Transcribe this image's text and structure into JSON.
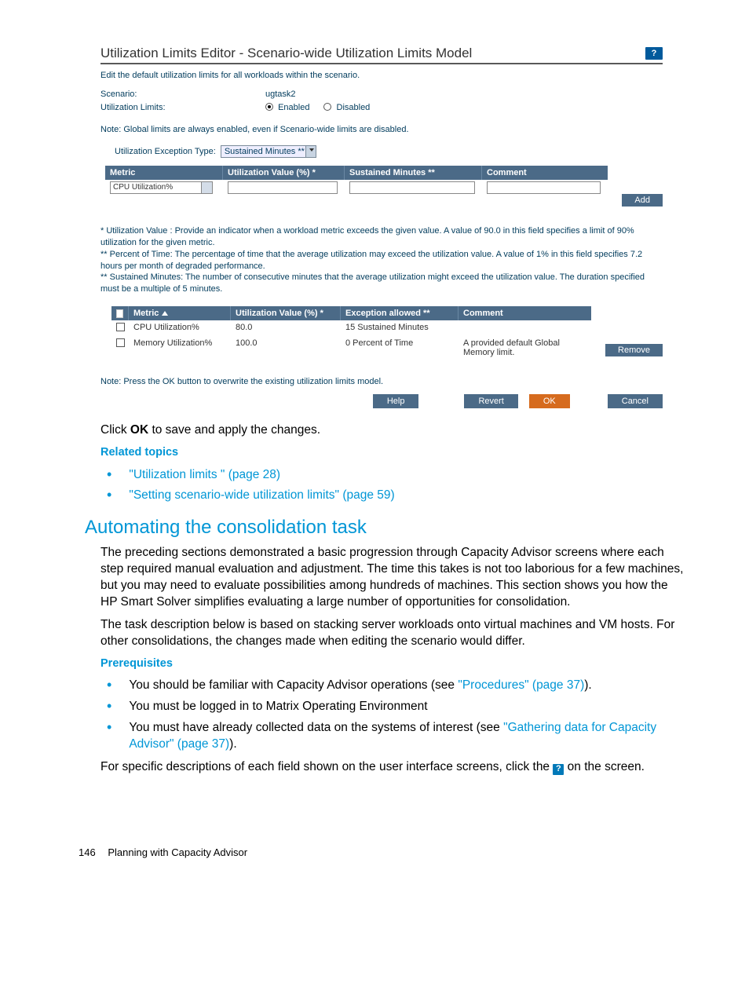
{
  "screenshot": {
    "title": "Utilization Limits Editor - Scenario-wide Utilization Limits Model",
    "help_badge": "?",
    "subtitle": "Edit the default utilization limits for all workloads within the scenario.",
    "scenario_label": "Scenario:",
    "scenario_value": "ugtask2",
    "util_limits_label": "Utilization Limits:",
    "radio_enabled": "Enabled",
    "radio_disabled": "Disabled",
    "note1": "Note: Global limits are always enabled, even if Scenario-wide limits are disabled.",
    "exc_type_label": "Utilization Exception Type:",
    "exc_type_value": "Sustained Minutes **",
    "entry_table": {
      "h_metric": "Metric",
      "h_util": "Utilization Value (%) *",
      "h_sust": "Sustained Minutes **",
      "h_comment": "Comment",
      "metric_value": "CPU Utilization%"
    },
    "add_btn": "Add",
    "explain": "* Utilization Value : Provide an indicator when a workload metric exceeds the given value. A value of 90.0 in this field specifies a limit of 90% utilization for the given metric.\n** Percent of Time: The percentage of time that the average utilization may exceed the utilization value. A value of 1% in this field specifies 7.2 hours per month of degraded performance.\n** Sustained Minutes: The number of consecutive minutes that the average utilization might exceed the utilization value. The duration specified must be a multiple of 5 minutes.",
    "list_table": {
      "h_metric": "Metric",
      "h_util": "Utilization Value (%) *",
      "h_exc": "Exception allowed **",
      "h_comment": "Comment",
      "rows": [
        {
          "metric": "CPU Utilization%",
          "util": "80.0",
          "exc": "15 Sustained Minutes",
          "comment": ""
        },
        {
          "metric": "Memory Utilization%",
          "util": "100.0",
          "exc": "0 Percent of Time",
          "comment": "A provided default Global Memory limit."
        }
      ]
    },
    "remove_btn": "Remove",
    "note2": "Note: Press the OK button to overwrite the existing utilization limits model.",
    "btn_help": "Help",
    "btn_revert": "Revert",
    "btn_ok": "OK",
    "btn_cancel": "Cancel"
  },
  "doc": {
    "after_ss_1a": "Click ",
    "after_ss_1b": "OK",
    "after_ss_1c": " to save and apply the changes.",
    "related_topics": "Related topics",
    "rt1": "\"Utilization limits \" (page 28)",
    "rt2": "\"Setting scenario-wide utilization limits\" (page 59)",
    "section_h": "Automating the consolidation task",
    "p1": "The preceding sections demonstrated a basic progression through Capacity Advisor screens where each step required manual evaluation and adjustment. The time this takes is not too laborious for a few machines, but you may need to evaluate possibilities among hundreds of machines. This section shows you how the HP Smart Solver simplifies evaluating a large number of opportunities for consolidation.",
    "p2": "The task description below is based on stacking server workloads onto virtual machines and VM hosts. For other consolidations, the changes made when editing the scenario would differ.",
    "prereq_h": "Prerequisites",
    "pr1a": "You should be familiar with Capacity Advisor operations (see ",
    "pr1b": "\"Procedures\" (page 37)",
    "pr1c": ").",
    "pr2": "You must be logged in to Matrix Operating Environment",
    "pr3a": "You must have already collected data on the systems of interest (see ",
    "pr3b": "\"Gathering data for Capacity Advisor\" (page 37)",
    "pr3c": ").",
    "final_a": "For specific descriptions of each field shown on the user interface screens, click the ",
    "final_b": " on the screen.",
    "help_q": "?",
    "page_num": "146",
    "footer_text": "Planning with Capacity Advisor"
  }
}
